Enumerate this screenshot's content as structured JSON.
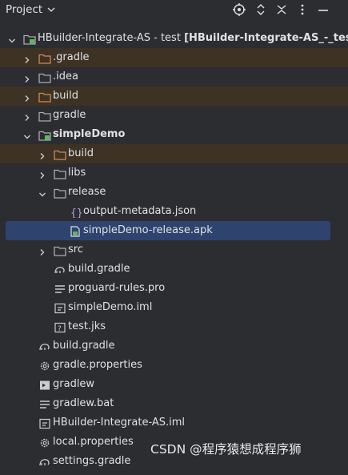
{
  "toolbar": {
    "title": "Project",
    "icons": [
      "chevron-down-icon",
      "locate-icon",
      "expand-collapse-icon",
      "close-icon",
      "more-icon",
      "minimize-icon"
    ]
  },
  "tree": [
    {
      "label": "HBuilder-Integrate-AS",
      "suffix": " - test ",
      "suffix_bold": "[HBuilder-Integrate-AS_-_test]",
      "icon": "module-folder-icon",
      "arrow": "expanded"
    },
    {
      "label": ".gradle",
      "icon": "excluded-folder-icon",
      "arrow": "collapsed",
      "excluded": true
    },
    {
      "label": ".idea",
      "icon": "folder-icon",
      "arrow": "collapsed"
    },
    {
      "label": "build",
      "icon": "excluded-folder-icon",
      "arrow": "collapsed",
      "excluded": true
    },
    {
      "label": "gradle",
      "icon": "folder-icon",
      "arrow": "collapsed"
    },
    {
      "label": "simpleDemo",
      "icon": "module-folder-icon",
      "arrow": "expanded",
      "bold": true
    },
    {
      "label": "build",
      "icon": "excluded-folder-icon",
      "arrow": "collapsed",
      "excluded": true
    },
    {
      "label": "libs",
      "icon": "folder-icon",
      "arrow": "collapsed"
    },
    {
      "label": "release",
      "icon": "folder-icon",
      "arrow": "expanded"
    },
    {
      "label": "output-metadata.json",
      "icon": "json-file-icon",
      "arrow": "none"
    },
    {
      "label": "simpleDemo-release.apk",
      "icon": "apk-file-icon",
      "arrow": "none",
      "selected": true
    },
    {
      "label": "src",
      "icon": "folder-icon",
      "arrow": "collapsed"
    },
    {
      "label": "build.gradle",
      "icon": "gradle-file-icon",
      "arrow": "none"
    },
    {
      "label": "proguard-rules.pro",
      "icon": "text-file-icon",
      "arrow": "none"
    },
    {
      "label": "simpleDemo.iml",
      "icon": "iml-file-icon",
      "arrow": "none"
    },
    {
      "label": "test.jks",
      "icon": "unknown-file-icon",
      "arrow": "none"
    },
    {
      "label": "build.gradle",
      "icon": "gradle-file-icon",
      "arrow": "none"
    },
    {
      "label": "gradle.properties",
      "icon": "settings-file-icon",
      "arrow": "none"
    },
    {
      "label": "gradlew",
      "icon": "terminal-file-icon",
      "arrow": "none"
    },
    {
      "label": "gradlew.bat",
      "icon": "text-file-icon",
      "arrow": "none"
    },
    {
      "label": "HBuilder-Integrate-AS.iml",
      "icon": "iml-file-icon",
      "arrow": "none"
    },
    {
      "label": "local.properties",
      "icon": "settings-file-icon",
      "arrow": "none"
    },
    {
      "label": "settings.gradle",
      "icon": "gradle-file-icon",
      "arrow": "none"
    }
  ],
  "watermark": "CSDN @程序猿想成程序狮",
  "colors": {
    "background": "#2b2d30",
    "excluded_row": "#3d3223",
    "selected_row": "#2e436e",
    "folder": "#a9acb3",
    "excluded_folder": "#d08a54",
    "module_badge": "#5fb85f",
    "json": "#b29bdc",
    "apk": "#5fb85f"
  }
}
